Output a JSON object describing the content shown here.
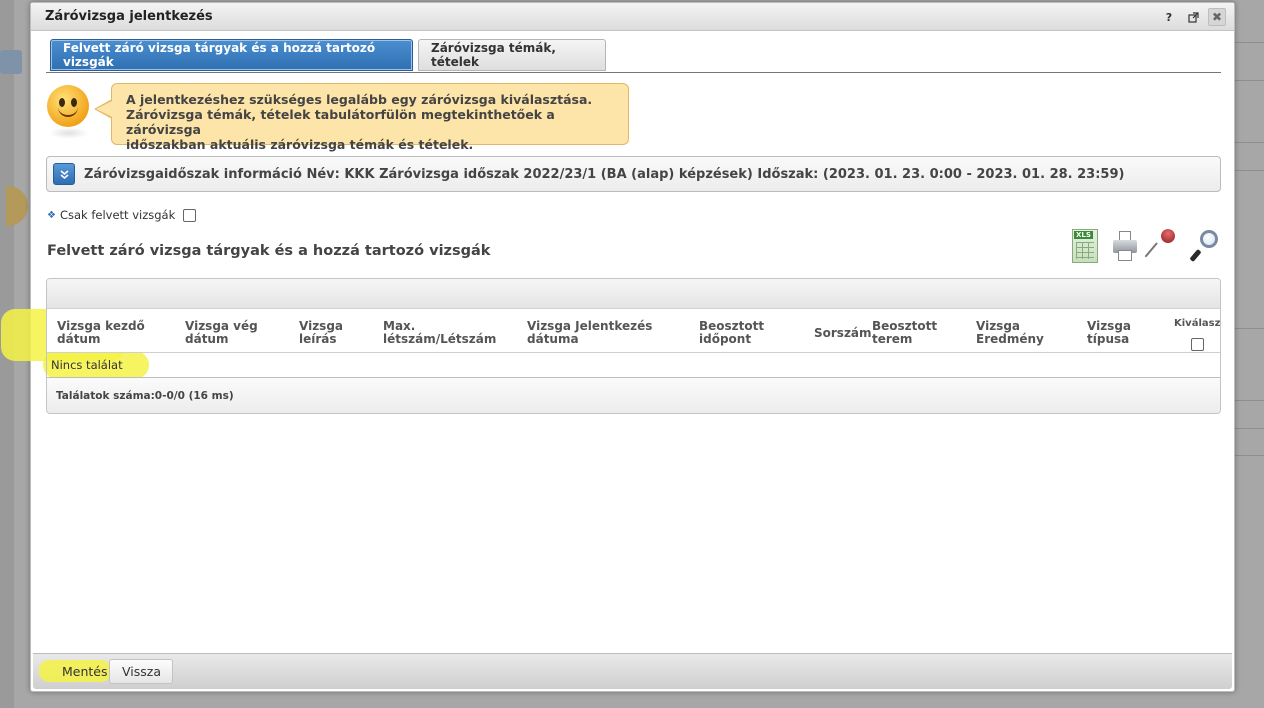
{
  "modal": {
    "title": "Záróvizsga jelentkezés",
    "help_label": "?"
  },
  "tabs": [
    {
      "label": "Felvett záró vizsga tárgyak és a hozzá tartozó vizsgák",
      "active": true
    },
    {
      "label": "Záróvizsga témák, tételek",
      "active": false
    }
  ],
  "hint": {
    "line1": "A jelentkezéshez szükséges legalább egy záróvizsga kiválasztása.",
    "line2": "Záróvizsga témák, tételek tabulátorfülön megtekinthetőek a záróvizsga",
    "line3": "időszakban aktuális záróvizsga témák és tételek."
  },
  "info": {
    "text": "Záróvizsgaidőszak információ Név: KKK Záróvizsga időszak 2022/23/1 (BA (alap) képzések) Időszak: (2023. 01. 23. 0:00 - 2023. 01. 28. 23:59)"
  },
  "filter": {
    "label": "Csak felvett vizsgák",
    "checked": false
  },
  "section": {
    "title": "Felvett záró vizsga tárgyak és a hozzá tartozó vizsgák"
  },
  "toolbar": {
    "xls_label": "XLS"
  },
  "table": {
    "columns": [
      {
        "l1": "Vizsga kezdő",
        "l2": "dátum"
      },
      {
        "l1": "Vizsga vég",
        "l2": "dátum"
      },
      {
        "l1": "Vizsga",
        "l2": "leírás"
      },
      {
        "l1": "Max.",
        "l2": "létszám/Létszám"
      },
      {
        "l1": "Vizsga Jelentkezés",
        "l2": "dátuma"
      },
      {
        "l1": "Beosztott",
        "l2": "időpont"
      },
      {
        "l1": "Sorszám",
        "l2": ""
      },
      {
        "l1": "Beosztott",
        "l2": "terem"
      },
      {
        "l1": "Vizsga",
        "l2": "Eredmény"
      },
      {
        "l1": "Vizsga",
        "l2": "típusa"
      },
      {
        "l1": "Kiválaszt",
        "l2": ""
      }
    ],
    "empty_text": "Nincs találat",
    "footer_text": "Találatok száma:0-0/0 (16 ms)"
  },
  "footer": {
    "save_label": "Mentés",
    "back_label": "Vissza"
  },
  "highlight_color": "#f4f244",
  "accent_color": "#2f6fb3"
}
